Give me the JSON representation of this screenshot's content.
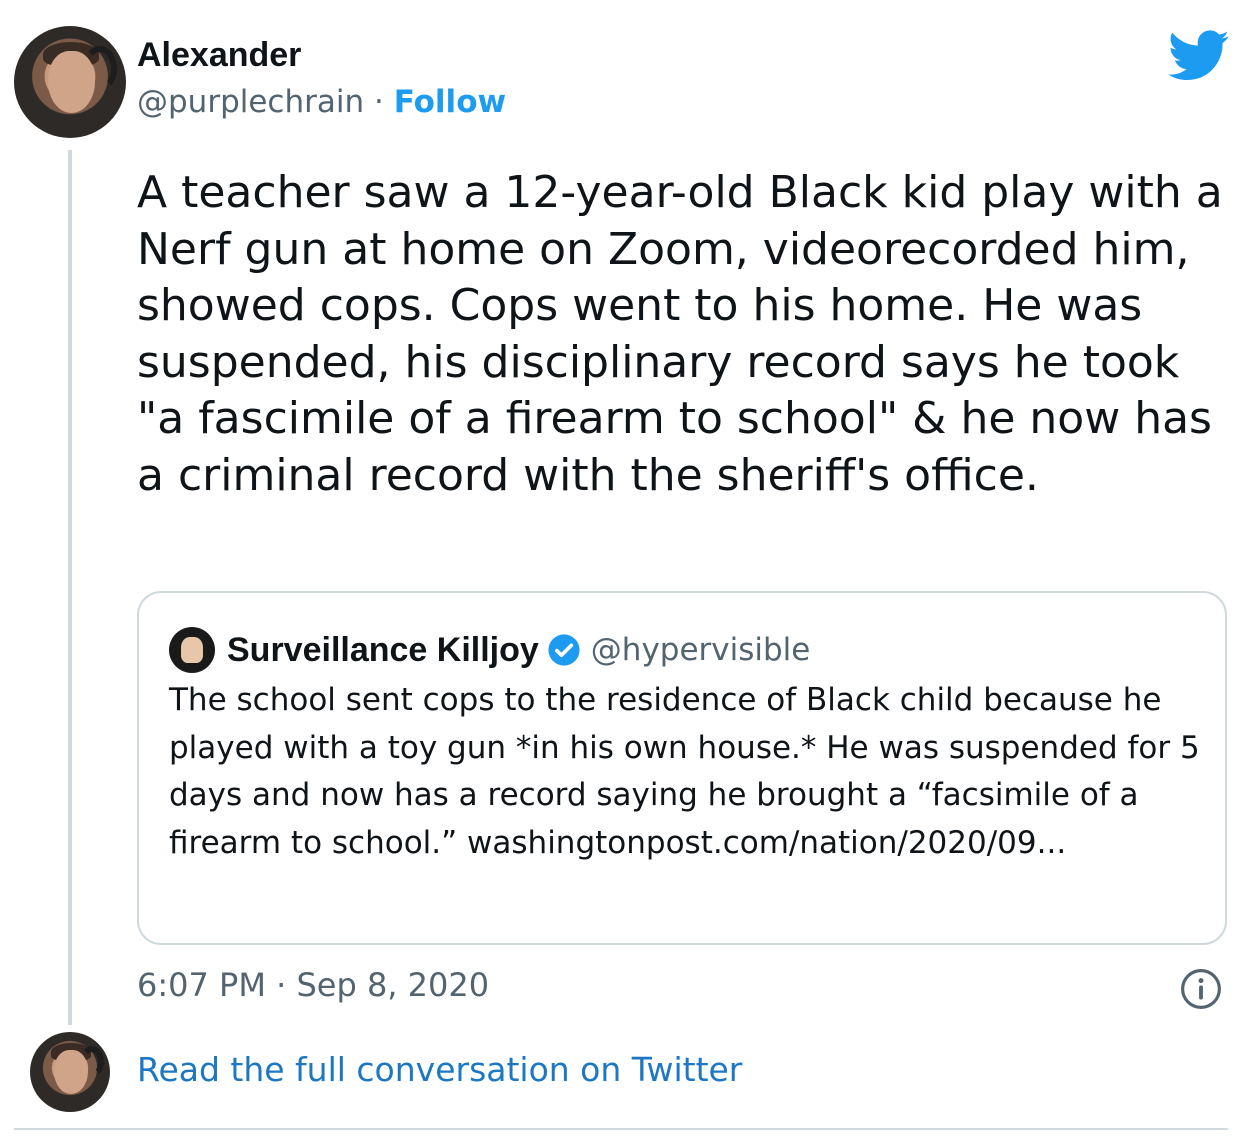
{
  "author": {
    "name": "Alexander",
    "handle": "@purplechrain",
    "separator": "·",
    "follow_label": "Follow"
  },
  "tweet": {
    "text": "A teacher saw a 12-year-old Black kid play with a Nerf gun at home on Zoom, videorecorded him, showed cops. Cops went to his home. He was suspended, his disciplinary record says he took \"a fascimile of a firearm to school\" & he now has a criminal record with the sheriff's office."
  },
  "quoted": {
    "name": "Surveillance Killjoy",
    "handle": "@hypervisible",
    "text": "The school sent cops to the residence of Black child because he played with a toy gun *in his own house.* He was suspended for 5 days and now has a record saying he brought a “facsimile of a firearm to school.” washingtonpost.com/nation/2020/09..."
  },
  "meta": {
    "timestamp": "6:07 PM · Sep 8, 2020"
  },
  "footer": {
    "read_more": "Read the full conversation on Twitter"
  },
  "icons": {
    "logo": "twitter-bird-icon",
    "verified": "verified-badge-icon",
    "info": "info-icon"
  },
  "colors": {
    "accent": "#1d9bf0",
    "link": "#1d77c2",
    "secondary_text": "#536471",
    "border": "#cfd9de"
  }
}
